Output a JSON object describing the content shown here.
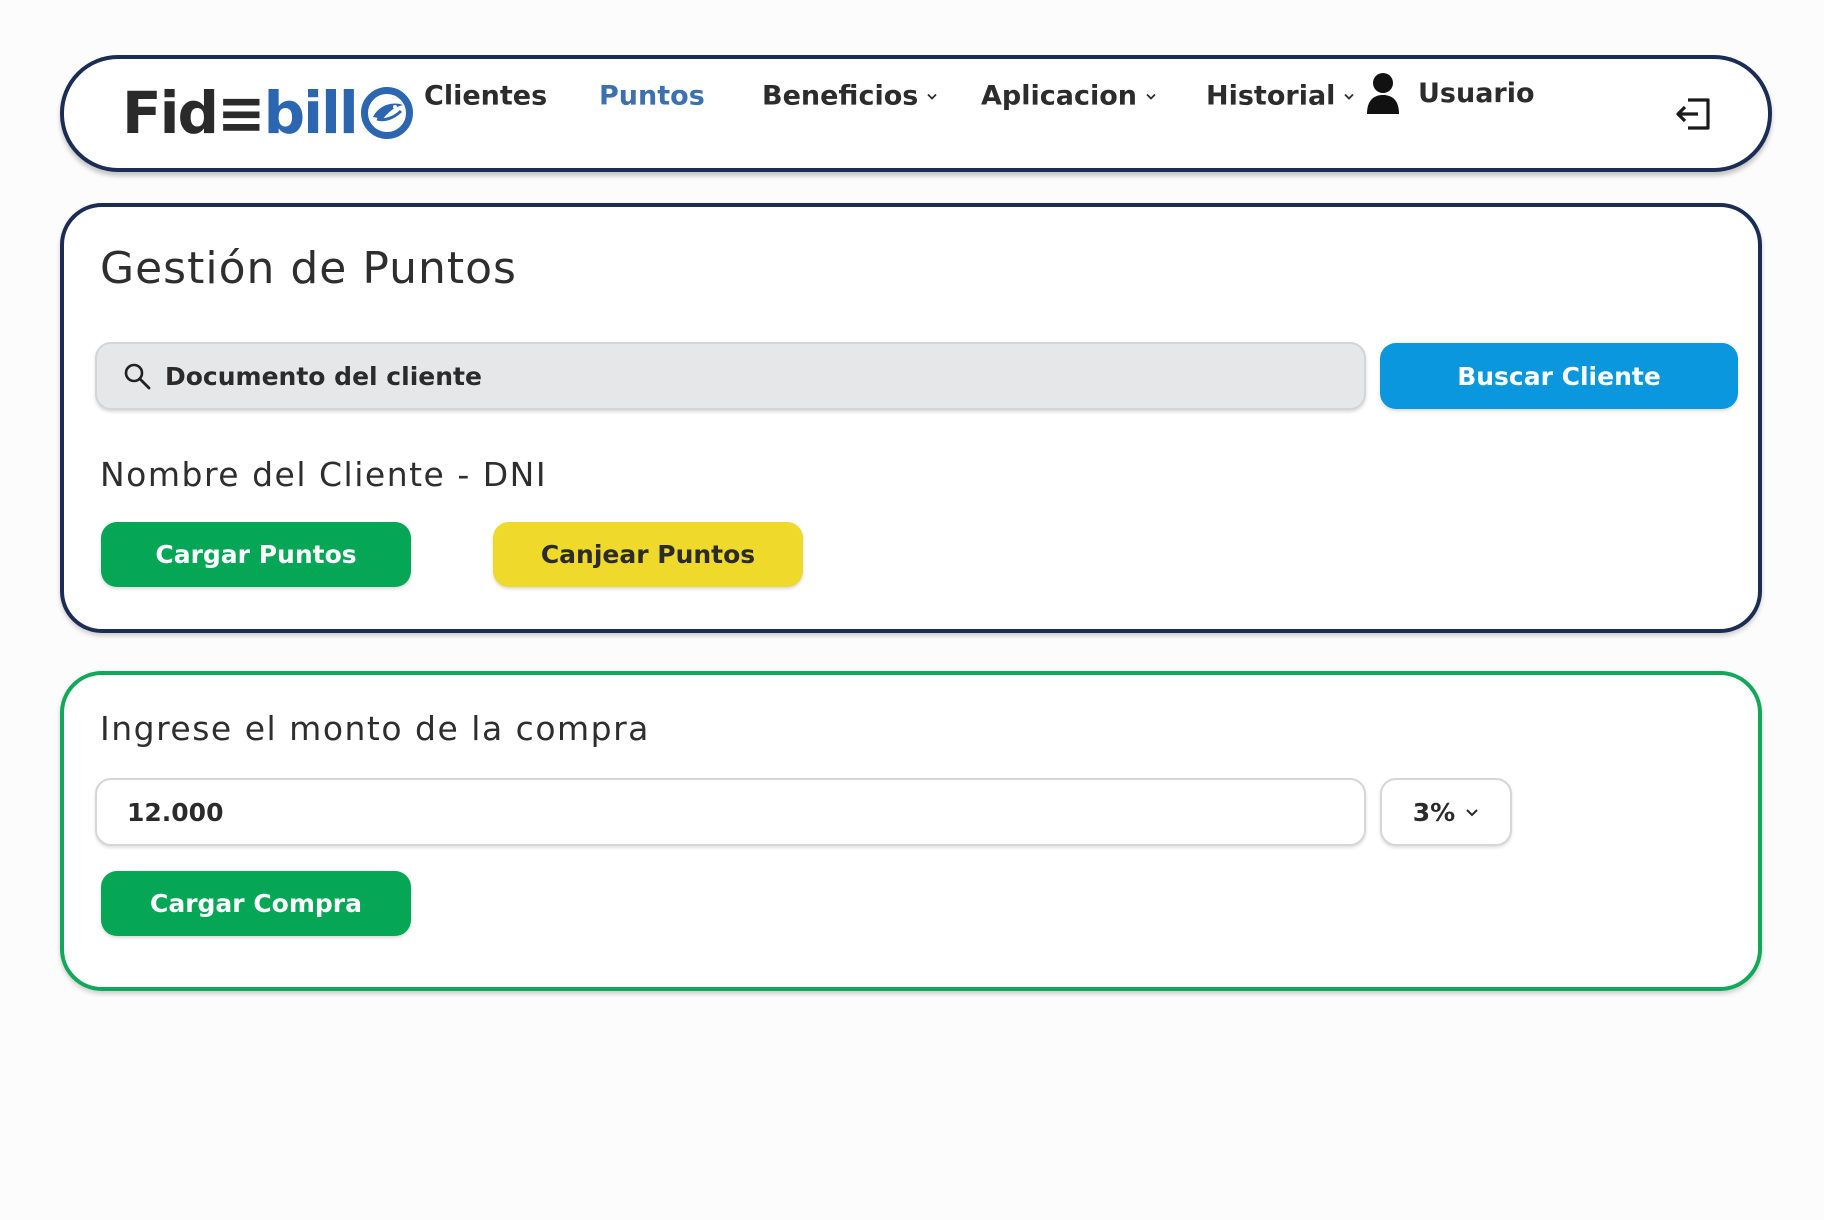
{
  "brand": {
    "logo_part1": "Fid≡",
    "logo_part2": "bill",
    "brand_color": "#2c66b0"
  },
  "nav": {
    "items": [
      {
        "label": "Clientes",
        "dropdown": false,
        "active": false
      },
      {
        "label": "Puntos",
        "dropdown": false,
        "active": true
      },
      {
        "label": "Beneficios",
        "dropdown": true,
        "active": false
      },
      {
        "label": "Aplicacion",
        "dropdown": true,
        "active": false
      },
      {
        "label": "Historial",
        "dropdown": true,
        "active": false
      }
    ],
    "user_label": "Usuario",
    "user_icon": "user-icon",
    "logout_icon": "logout-icon",
    "active_color": "#3c71ad"
  },
  "points_panel": {
    "title": "Gestión de Puntos",
    "search_placeholder": "Documento del cliente",
    "search_icon": "search-icon",
    "search_button": "Buscar Cliente",
    "client_name": "Nombre del Cliente - DNI",
    "load_points_button": "Cargar Puntos",
    "redeem_points_button": "Canjear Puntos",
    "border_color": "#1b2d55"
  },
  "purchase_panel": {
    "label": "Ingrese el monto de la compra",
    "amount_value": "12.000",
    "percent_value": "3%",
    "load_purchase_button": "Cargar Compra",
    "border_color": "#12a85a"
  },
  "colors": {
    "blue_button": "#0a97dd",
    "green_button": "#05a756",
    "yellow_button": "#efd92b"
  }
}
